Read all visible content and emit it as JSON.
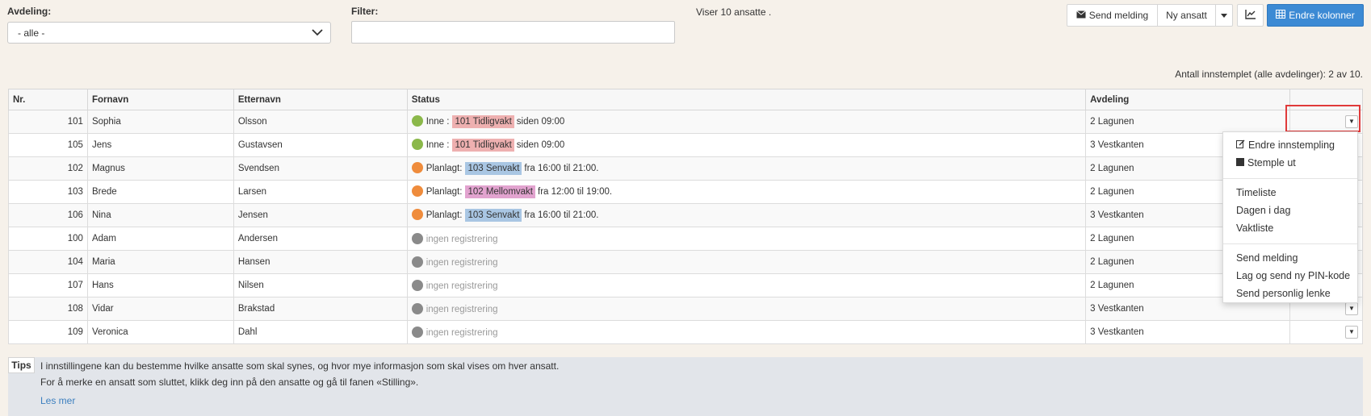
{
  "department": {
    "label": "Avdeling:",
    "value": "- alle -"
  },
  "filter": {
    "label": "Filter:",
    "value": ""
  },
  "showing_text": "Viser 10 ansatte .",
  "toolbar": {
    "send_message": "Send melding",
    "new_employee": "Ny ansatt",
    "change_columns": "Endre kolonner"
  },
  "clocked_in_count": "Antall innstemplet (alle avdelinger): 2 av 10.",
  "table": {
    "headers": {
      "nr": "Nr.",
      "first": "Fornavn",
      "last": "Etternavn",
      "status": "Status",
      "dept": "Avdeling"
    },
    "rows": [
      {
        "nr": "101",
        "first": "Sophia",
        "last": "Olsson",
        "status_prefix": "Inne :",
        "shift": "101 Tidligvakt",
        "status_suffix": "siden 09:00",
        "dept": "2 Lagunen",
        "state": "in"
      },
      {
        "nr": "105",
        "first": "Jens",
        "last": "Gustavsen",
        "status_prefix": "Inne :",
        "shift": "101 Tidligvakt",
        "status_suffix": "siden 09:00",
        "dept": "3 Vestkanten",
        "state": "in"
      },
      {
        "nr": "102",
        "first": "Magnus",
        "last": "Svendsen",
        "status_prefix": "Planlagt:",
        "shift": "103 Senvakt",
        "status_suffix": "fra 16:00 til 21:00.",
        "dept": "2 Lagunen",
        "state": "planned"
      },
      {
        "nr": "103",
        "first": "Brede",
        "last": "Larsen",
        "status_prefix": "Planlagt:",
        "shift": "102 Mellomvakt",
        "status_suffix": "fra 12:00 til 19:00.",
        "dept": "2 Lagunen",
        "state": "planned"
      },
      {
        "nr": "106",
        "first": "Nina",
        "last": "Jensen",
        "status_prefix": "Planlagt:",
        "shift": "103 Senvakt",
        "status_suffix": "fra 16:00 til 21:00.",
        "dept": "3 Vestkanten",
        "state": "planned"
      },
      {
        "nr": "100",
        "first": "Adam",
        "last": "Andersen",
        "status_prefix": "ingen registrering",
        "shift": "",
        "status_suffix": "",
        "dept": "2 Lagunen",
        "state": "none"
      },
      {
        "nr": "104",
        "first": "Maria",
        "last": "Hansen",
        "status_prefix": "ingen registrering",
        "shift": "",
        "status_suffix": "",
        "dept": "2 Lagunen",
        "state": "none"
      },
      {
        "nr": "107",
        "first": "Hans",
        "last": "Nilsen",
        "status_prefix": "ingen registrering",
        "shift": "",
        "status_suffix": "",
        "dept": "2 Lagunen",
        "state": "none"
      },
      {
        "nr": "108",
        "first": "Vidar",
        "last": "Brakstad",
        "status_prefix": "ingen registrering",
        "shift": "",
        "status_suffix": "",
        "dept": "3 Vestkanten",
        "state": "none"
      },
      {
        "nr": "109",
        "first": "Veronica",
        "last": "Dahl",
        "status_prefix": "ingen registrering",
        "shift": "",
        "status_suffix": "",
        "dept": "3 Vestkanten",
        "state": "none"
      }
    ]
  },
  "shift_colors": {
    "101 Tidligvakt": "#eeb0b0",
    "103 Senvakt": "#a9c6e3",
    "102 Mellomvakt": "#e2a3cf"
  },
  "state_colors": {
    "in": "#8bb84a",
    "planned": "#ef8c3c",
    "none": "#8a8a8a"
  },
  "row_menu": {
    "edit_clockin": "Endre innstempling",
    "clock_out": "Stemple ut",
    "timesheet": "Timeliste",
    "today": "Dagen i dag",
    "shift_list": "Vaktliste",
    "send_message": "Send melding",
    "new_pin": "Lag og send ny PIN-kode",
    "personal_link": "Send personlig lenke"
  },
  "tips": {
    "label": "Tips",
    "line1": "I innstillingene kan du bestemme hvilke ansatte som skal synes, og hvor mye informasjon som skal vises om hver ansatt.",
    "line2": "For å merke en ansatt som sluttet, klikk deg inn på den ansatte og gå til fanen «Stilling».",
    "read_more": "Les mer"
  },
  "icons": [
    "chevron-down-icon",
    "envelope-icon",
    "caret-down-icon",
    "chart-icon",
    "table-icon",
    "edit-icon",
    "stop-icon"
  ]
}
